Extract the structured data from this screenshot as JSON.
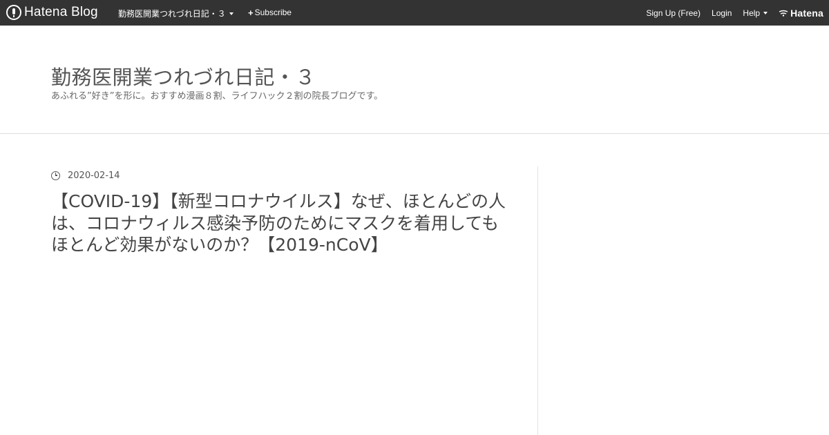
{
  "topbar": {
    "logo_text": "Hatena Blog",
    "blog_menu_label": "勤務医開業つれづれ日記・３",
    "subscribe_label": "Subscribe",
    "signup_label": "Sign Up (Free)",
    "login_label": "Login",
    "help_label": "Help",
    "brand_label": "Hatena"
  },
  "header": {
    "title": "勤務医開業つれづれ日記・３",
    "description": "あふれる”好き”を形に。おすすめ漫画８割、ライフハック２割の院長ブログです。"
  },
  "entry": {
    "date": "2020-02-14",
    "title": "【COVID-19】【新型コロナウイルス】なぜ、ほとんどの人は、コロナウィルス感染予防のためにマスクを着用してもほとんど効果がないのか？【2019-nCoV】"
  },
  "colors": {
    "topbar_bg": "#333333",
    "text": "#444444"
  }
}
